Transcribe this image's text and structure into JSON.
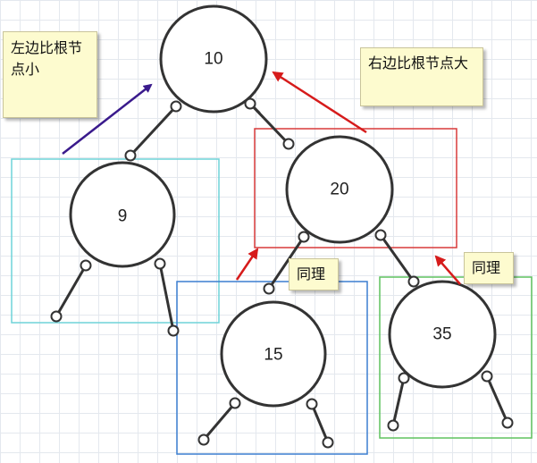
{
  "nodes": [
    {
      "id": "root",
      "label": "10"
    },
    {
      "id": "n9",
      "label": "9"
    },
    {
      "id": "n20",
      "label": "20"
    },
    {
      "id": "n15",
      "label": "15"
    },
    {
      "id": "n35",
      "label": "35"
    }
  ],
  "notes": {
    "left": "左边比根节点小",
    "right": "右边比根节点大",
    "same1": "同理",
    "same2": "同理"
  },
  "colors": {
    "node_stroke": "#333333",
    "box_left": "#6fd3d8",
    "box_right": "#d83a3a",
    "box_15": "#3c7fd0",
    "box_35": "#5fc25f",
    "arrow_left": "#3a1a8c",
    "arrow_red": "#d61b1b"
  }
}
